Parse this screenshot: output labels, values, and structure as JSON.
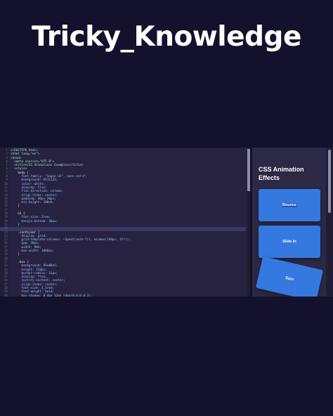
{
  "title": "Tricky_Knowledge",
  "editor": {
    "lines": [
      "<!DOCTYPE html>",
      "<html lang=\"en\">",
      "<head>",
      "  <meta charset=\"UTF-8\">",
      "  <title>CSS Animations Examples</title>",
      "  <style>",
      "    body {",
      "      font-family: \"Segoe UI\", sans-serif;",
      "      background: #111122;",
      "      color: white;",
      "      display: flex;",
      "      flex-direction: column;",
      "      align-items: center;",
      "      padding: 40px 20px;",
      "      min-height: 100vh;",
      "    }",
      "",
      "    h1 {",
      "      font-size: 2rem;",
      "      margin-bottom: 30px;",
      "    }",
      "",
      "    .container {",
      "      display: grid;",
      "      grid-template-columns: repeat(auto-fit, minmax(140px, 1fr));",
      "      gap: 30px;",
      "      width: 90%;",
      "      max-width: 1000px;",
      "    }",
      "",
      "    .box {",
      "      background: #1e88e5;",
      "      height: 150px;",
      "      border-radius: 12px;",
      "      display: flex;",
      "      justify-content: center;",
      "      align-items: center;",
      "      font-size: 1.1rem;",
      "      font-weight: bold;",
      "      box-shadow: 0 4px 12px rgba(0,0,0,0.3);",
      "      transition: 0.3s;",
      "      cursor: pointer;",
      "      animation-duration: 2s;"
    ],
    "active_line_index": 21
  },
  "preview": {
    "heading": "CSS Animation Effects",
    "boxes": {
      "bounce": "Bounce",
      "slide": "Slide In",
      "spin": "Spin"
    }
  },
  "colors": {
    "page_background": "#13112b",
    "editor_background": "#26223f",
    "preview_background": "#2b2946",
    "box_accent": "#3578e0"
  }
}
